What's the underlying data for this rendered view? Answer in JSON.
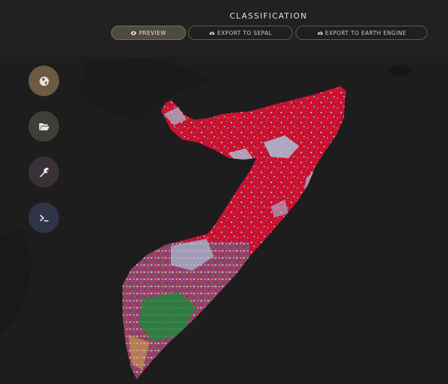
{
  "header": {
    "title": "CLASSIFICATION"
  },
  "actions": {
    "preview_label": "PREVIEW",
    "export_sepal_label": "EXPORT TO SEPAL",
    "export_ee_label": "EXPORT TO EARTH ENGINE"
  },
  "icons": {
    "preview": "eye-icon",
    "export_sepal": "cloud-upload-icon",
    "export_ee": "cloud-upload-icon",
    "side_1": "globe-icon",
    "side_2": "folder-open-icon",
    "side_3": "wrench-icon",
    "side_4": "terminal-icon"
  },
  "colors": {
    "side_1": "#6d5a42",
    "side_2": "#3c4039",
    "side_3": "#3a3138",
    "side_4": "#2f3547",
    "class_red": "#cc1030",
    "class_blue": "#a9c2d6",
    "class_green": "#1a8a3a",
    "class_purple": "#8a4a7a",
    "class_yellow": "#d9b34a"
  }
}
